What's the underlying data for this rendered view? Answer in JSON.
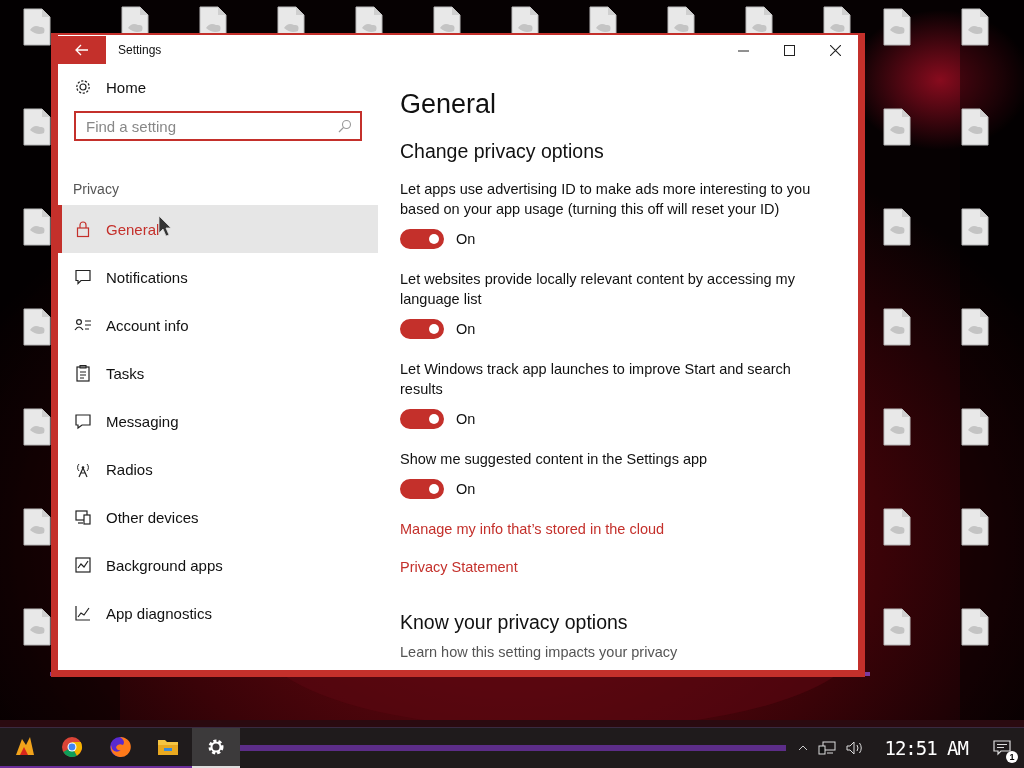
{
  "window": {
    "title": "Settings"
  },
  "nav": {
    "home": "Home",
    "search": {
      "placeholder": "Find a setting"
    },
    "section": "Privacy",
    "items": [
      {
        "label": "General",
        "kind": "lock",
        "selected": true
      },
      {
        "label": "Notifications",
        "kind": "note",
        "selected": false
      },
      {
        "label": "Account info",
        "kind": "account",
        "selected": false
      },
      {
        "label": "Tasks",
        "kind": "tasks",
        "selected": false
      },
      {
        "label": "Messaging",
        "kind": "message",
        "selected": false
      },
      {
        "label": "Radios",
        "kind": "radio",
        "selected": false
      },
      {
        "label": "Other devices",
        "kind": "devices",
        "selected": false
      },
      {
        "label": "Background apps",
        "kind": "background",
        "selected": false
      },
      {
        "label": "App diagnostics",
        "kind": "diagnostics",
        "selected": false
      }
    ]
  },
  "content": {
    "title": "General",
    "heading": "Change privacy options",
    "toggles": [
      {
        "label": "Let apps use advertising ID to make ads more interesting to you based on your app usage (turning this off will reset your ID)",
        "on": true,
        "state_text": "On"
      },
      {
        "label": "Let websites provide locally relevant content by accessing my language list",
        "on": true,
        "state_text": "On"
      },
      {
        "label": "Let Windows track app launches to improve Start and search results",
        "on": true,
        "state_text": "On"
      },
      {
        "label": "Show me suggested content in the Settings app",
        "on": true,
        "state_text": "On"
      }
    ],
    "links": [
      "Manage my info that’s stored in the cloud",
      "Privacy Statement"
    ],
    "heading2": "Know your privacy options",
    "note": "Learn how this setting impacts your privacy"
  },
  "taskbar": {
    "apps": [
      {
        "kind": "logo",
        "selected": false
      },
      {
        "kind": "chrome",
        "selected": false
      },
      {
        "kind": "firefox",
        "selected": false
      },
      {
        "kind": "folder",
        "selected": false
      },
      {
        "kind": "gear",
        "selected": true
      }
    ],
    "clock": "12:51 AM",
    "notifications": "1"
  }
}
